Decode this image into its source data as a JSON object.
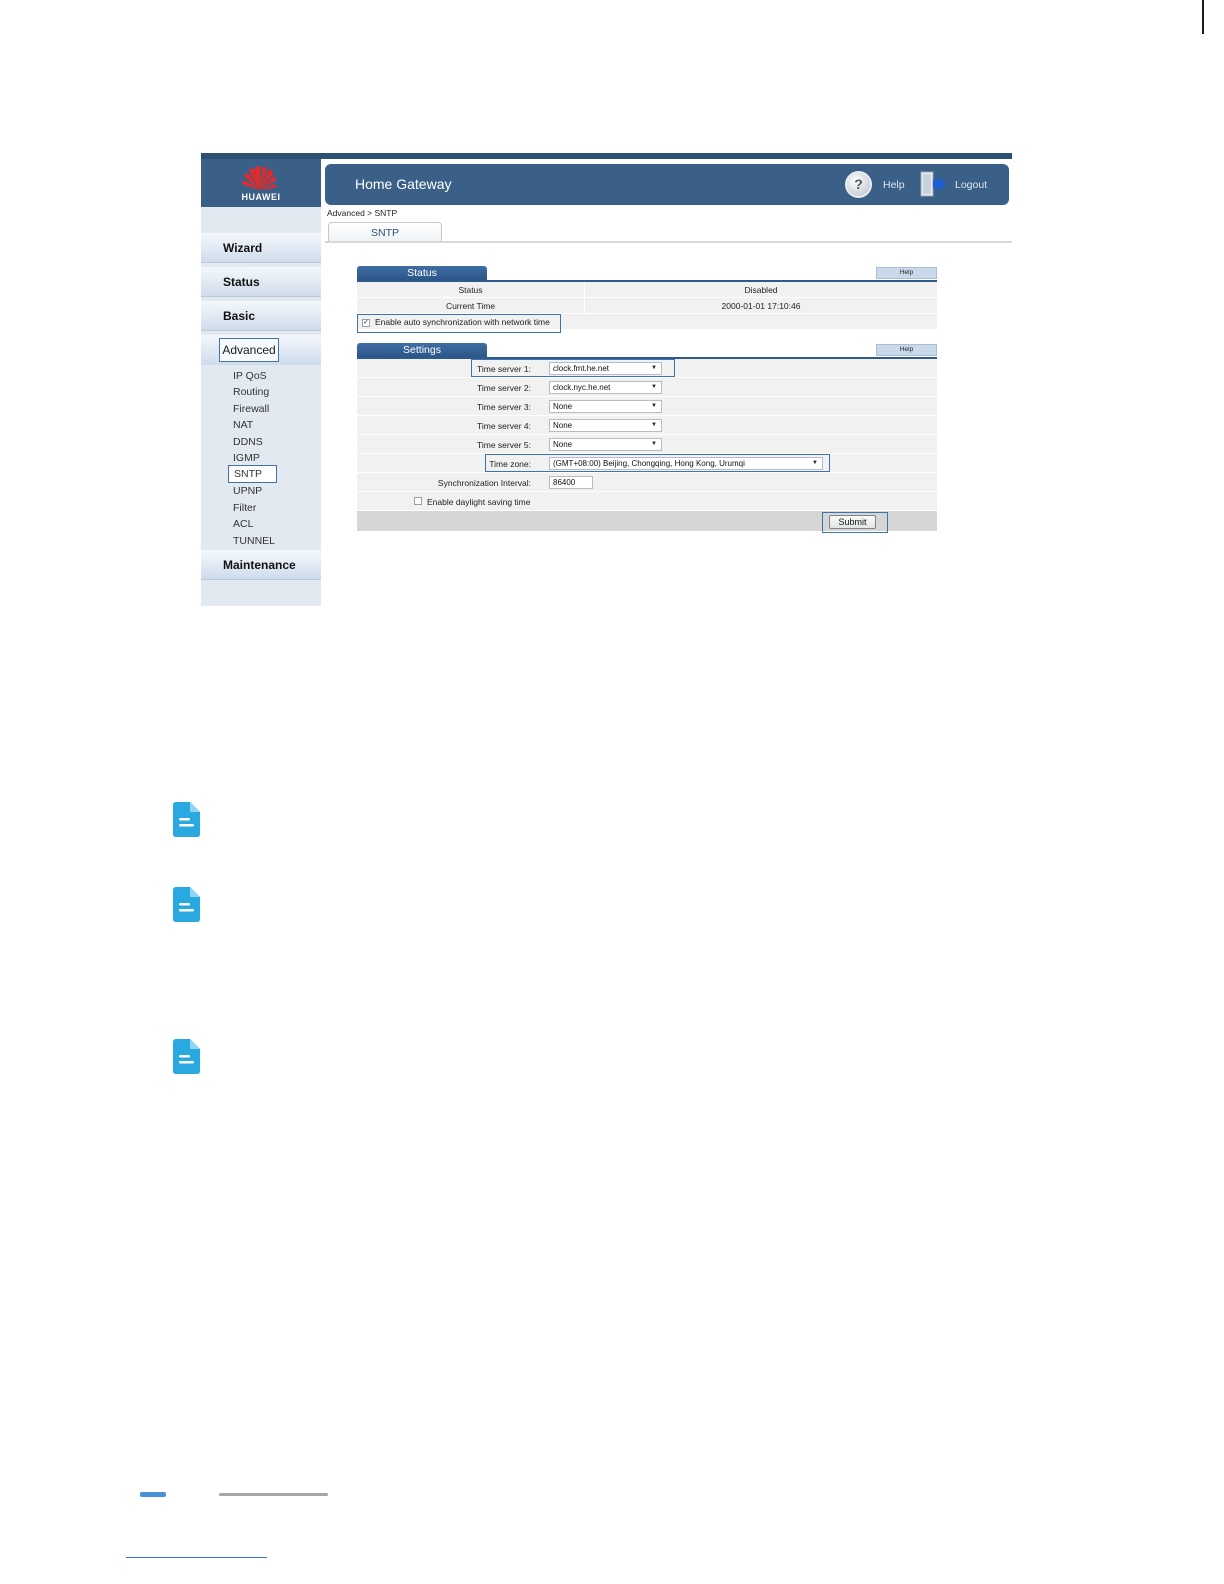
{
  "app": {
    "brand": "HUAWEI",
    "title": "Home Gateway",
    "help_label": "Help",
    "logout_label": "Logout",
    "breadcrumb": "Advanced > SNTP",
    "active_tab": "SNTP"
  },
  "sidebar": {
    "top_items": [
      {
        "label": "Wizard"
      },
      {
        "label": "Status"
      },
      {
        "label": "Basic"
      }
    ],
    "advanced_label": "Advanced",
    "sub_items": [
      {
        "label": "IP QoS"
      },
      {
        "label": "Routing"
      },
      {
        "label": "Firewall"
      },
      {
        "label": "NAT"
      },
      {
        "label": "DDNS"
      },
      {
        "label": "IGMP"
      },
      {
        "label": "SNTP"
      },
      {
        "label": "UPNP"
      },
      {
        "label": "Filter"
      },
      {
        "label": "ACL"
      },
      {
        "label": "TUNNEL"
      }
    ],
    "maintenance_label": "Maintenance"
  },
  "status_panel": {
    "tab_label": "Status",
    "help_label": "Help",
    "rows": [
      {
        "label": "Status",
        "value": "Disabled"
      },
      {
        "label": "Current Time",
        "value": "2000-01-01 17:10:46"
      }
    ],
    "auto_sync_label": "Enable auto synchronization with network time",
    "auto_sync_checked": true
  },
  "settings_panel": {
    "tab_label": "Settings",
    "help_label": "Help",
    "time_servers": [
      {
        "label": "Time server 1:",
        "value": "clock.fmt.he.net"
      },
      {
        "label": "Time server 2:",
        "value": "clock.nyc.he.net"
      },
      {
        "label": "Time server 3:",
        "value": "None"
      },
      {
        "label": "Time server 4:",
        "value": "None"
      },
      {
        "label": "Time server 5:",
        "value": "None"
      }
    ],
    "timezone_label": "Time zone:",
    "timezone_value": "(GMT+08:00) Beijing, Chongqing, Hong Kong, Urumqi",
    "sync_interval_label": "Synchronization Interval:",
    "sync_interval_value": "86400",
    "dst_label": "Enable daylight saving time",
    "dst_checked": false,
    "submit_label": "Submit"
  },
  "colors": {
    "header_blue": "#3a6088",
    "accent_blue": "#3c73b0",
    "note_icon": "#29a9e0",
    "footer_accent": "#4a90d9"
  },
  "icons": {
    "note": "document-note-icon",
    "help": "question-circle-icon",
    "logout": "logout-door-icon",
    "dropdown": "caret-down-icon"
  }
}
